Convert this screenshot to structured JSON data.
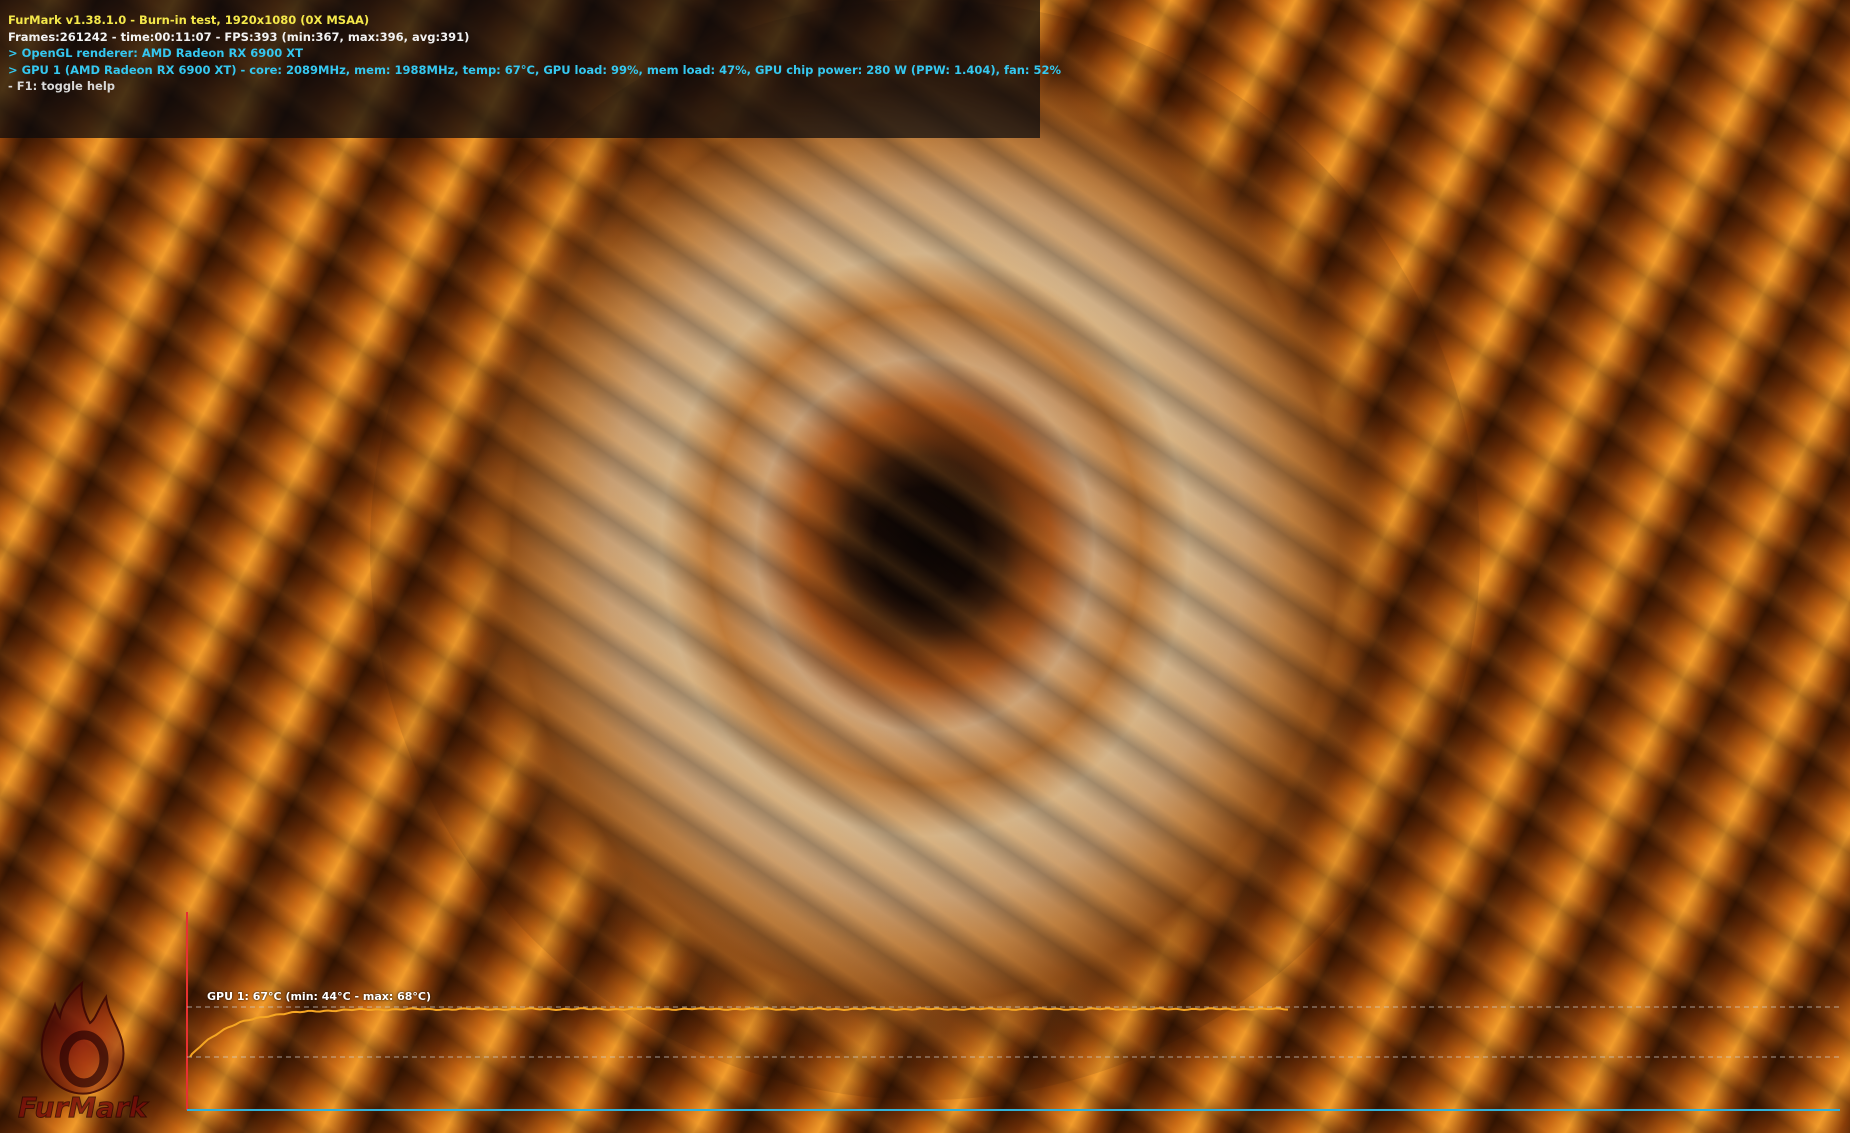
{
  "hud": {
    "line1": "FurMark v1.38.1.0 - Burn-in test, 1920x1080 (0X MSAA)",
    "line2": "Frames:261242 - time:00:11:07 - FPS:393 (min:367, max:396, avg:391)",
    "line3": "> OpenGL renderer: AMD Radeon RX 6900 XT",
    "line4": "> GPU 1 (AMD Radeon RX 6900 XT) - core: 2089MHz, mem: 1988MHz, temp: 67°C, GPU load: 99%, mem load: 47%, GPU chip power: 280 W (PPW: 1.404), fan: 52%",
    "line5": "- F1: toggle help"
  },
  "graph": {
    "label": "GPU 1: 67°C (min: 44°C - max: 68°C)",
    "current_temp_c": 67,
    "min_temp_c": 44,
    "max_temp_c": 68
  },
  "logo": {
    "text": "FurMark"
  },
  "colors": {
    "hud_title": "#f4e84a",
    "hud_info": "#35c8f0",
    "graph_line": "#f5a623",
    "graph_axis_x": "#2fb0d8",
    "graph_axis_y": "#e83030"
  }
}
